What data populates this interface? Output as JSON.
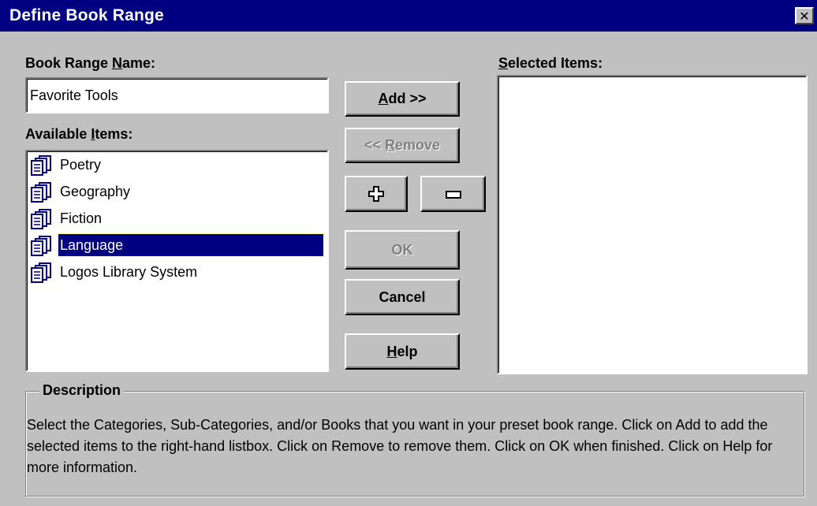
{
  "window": {
    "title": "Define Book Range",
    "close_glyph": "✕"
  },
  "name_field": {
    "label_pre": "Book Range ",
    "label_access": "N",
    "label_post": "ame:",
    "value": "Favorite Tools"
  },
  "available": {
    "label_pre": "Available ",
    "label_access": "I",
    "label_post": "tems:",
    "items": [
      {
        "label": "Poetry",
        "icon": "books-icon",
        "selected": false
      },
      {
        "label": "Geography",
        "icon": "books-icon",
        "selected": false
      },
      {
        "label": "Fiction",
        "icon": "books-icon",
        "selected": false
      },
      {
        "label": "Language",
        "icon": "books-icon",
        "selected": true
      },
      {
        "label": "Logos Library System",
        "icon": "books-icon",
        "selected": false
      }
    ]
  },
  "selected": {
    "label_access": "S",
    "label_post": "elected Items:",
    "items": []
  },
  "buttons": {
    "add_access": "A",
    "add_rest": "dd >>",
    "remove_pre": "<< ",
    "remove_access": "R",
    "remove_rest": "emove",
    "expand_icon": "plus-icon",
    "collapse_icon": "minus-icon",
    "ok": "OK",
    "cancel": "Cancel",
    "help_access": "H",
    "help_rest": "elp"
  },
  "description": {
    "title": "Description",
    "text": "Select the Categories, Sub-Categories, and/or Books that you want in your preset book range. Click on Add to add the selected items to the right-hand listbox. Click on Remove to remove them. Click on OK when finished. Click on Help for more information."
  },
  "colors": {
    "title_bar": "#000080",
    "dialog_bg": "#c0c0c0",
    "selection": "#000080"
  }
}
